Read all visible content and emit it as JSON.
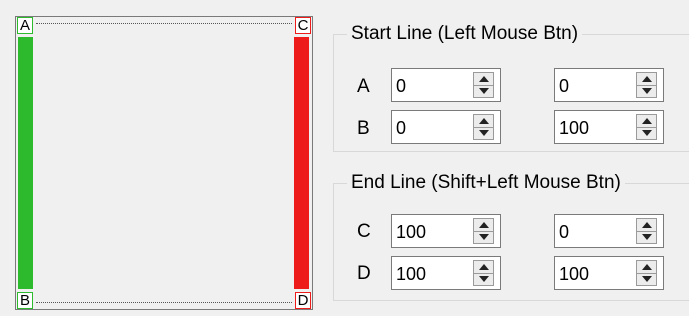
{
  "preview": {
    "corner_a": "A",
    "corner_b": "B",
    "corner_c": "C",
    "corner_d": "D",
    "start_line_color": "#2dbb2d",
    "end_line_color": "#ee1b1b"
  },
  "start_group": {
    "title": "Start Line (Left Mouse Btn)",
    "rows": [
      {
        "label": "A",
        "x": "0",
        "y": "0"
      },
      {
        "label": "B",
        "x": "0",
        "y": "100"
      }
    ]
  },
  "end_group": {
    "title": "End Line (Shift+Left Mouse Btn)",
    "rows": [
      {
        "label": "C",
        "x": "100",
        "y": "0"
      },
      {
        "label": "D",
        "x": "100",
        "y": "100"
      }
    ]
  },
  "icons": {
    "spin_up": "triangle-up-icon",
    "spin_down": "triangle-down-icon"
  }
}
